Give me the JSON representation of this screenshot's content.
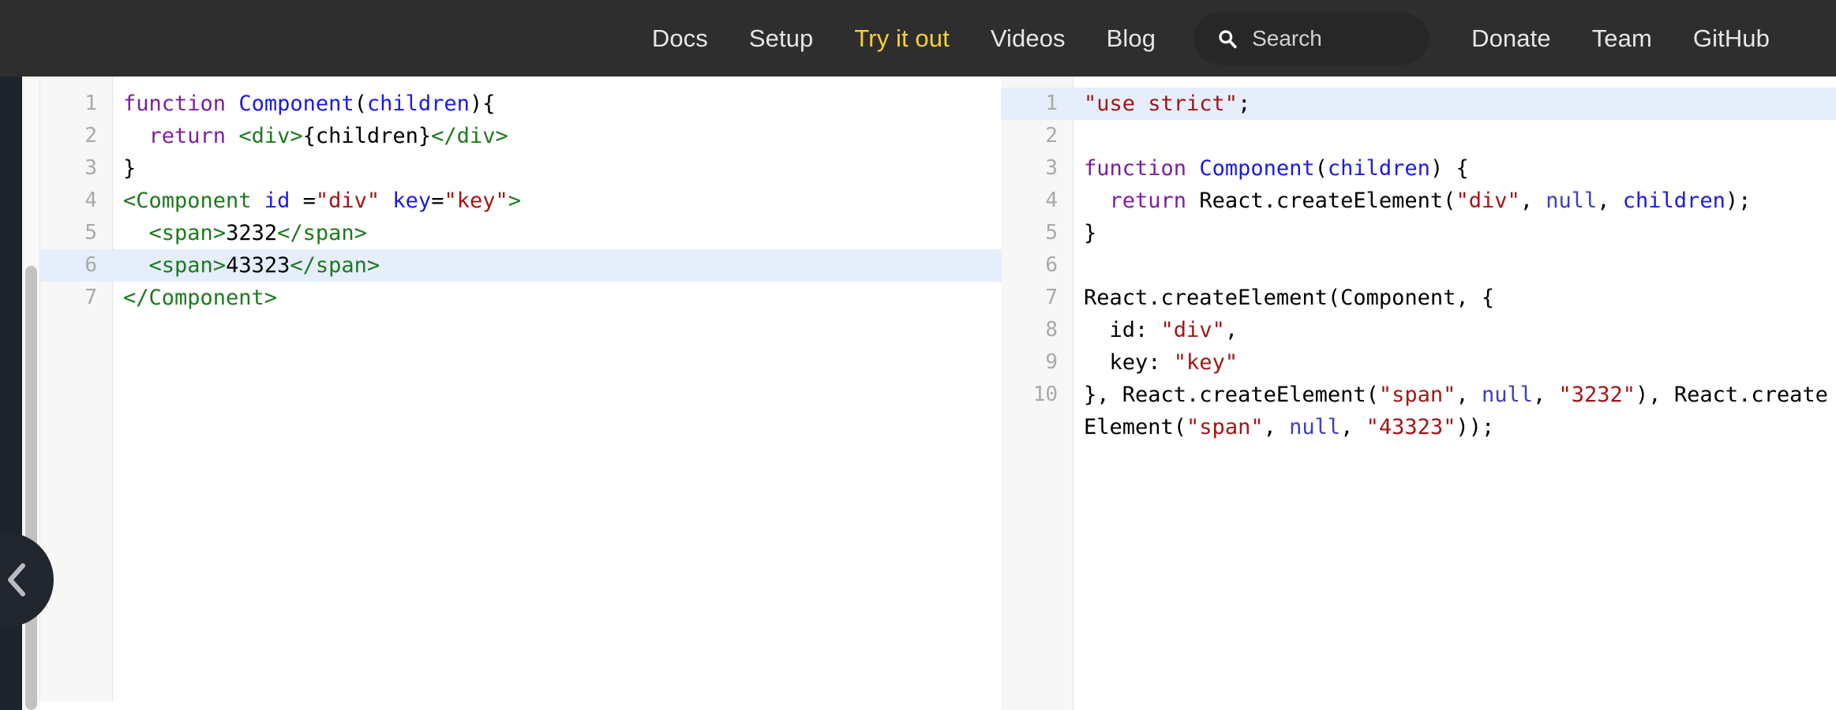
{
  "navbar": {
    "links": [
      {
        "label": "Docs",
        "name": "nav-link-docs",
        "active": false
      },
      {
        "label": "Setup",
        "name": "nav-link-setup",
        "active": false
      },
      {
        "label": "Try it out",
        "name": "nav-link-try-it-out",
        "active": true
      },
      {
        "label": "Videos",
        "name": "nav-link-videos",
        "active": false
      },
      {
        "label": "Blog",
        "name": "nav-link-blog",
        "active": false
      }
    ],
    "search": {
      "placeholder": "Search",
      "value": "",
      "icon": "search-icon"
    },
    "right_links": [
      {
        "label": "Donate",
        "name": "nav-link-donate"
      },
      {
        "label": "Team",
        "name": "nav-link-team"
      },
      {
        "label": "GitHub",
        "name": "nav-link-github"
      }
    ],
    "background_color": "#2e2e2e",
    "active_color": "#f5d033",
    "text_color": "#e6e6e6"
  },
  "sidebar": {
    "collapse_button": {
      "icon": "chevron-left-icon",
      "name": "sidebar-collapse-button"
    },
    "background_color": "#1e242e"
  },
  "editor_left": {
    "name": "source-code-editor",
    "highlighted_line": 6,
    "line_numbers": [
      "1",
      "2",
      "3",
      "4",
      "5",
      "6",
      "7"
    ],
    "lines": [
      {
        "number": "1",
        "highlight": false,
        "tokens": [
          {
            "text": "function",
            "cls": "t-kw"
          },
          {
            "text": " ",
            "cls": "t-plain"
          },
          {
            "text": "Component",
            "cls": "t-fn"
          },
          {
            "text": "(",
            "cls": "t-punct"
          },
          {
            "text": "children",
            "cls": "t-param"
          },
          {
            "text": "){",
            "cls": "t-punct"
          }
        ]
      },
      {
        "number": "2",
        "highlight": false,
        "tokens": [
          {
            "text": "  ",
            "cls": "t-plain"
          },
          {
            "text": "return",
            "cls": "t-kw"
          },
          {
            "text": " ",
            "cls": "t-plain"
          },
          {
            "text": "<div>",
            "cls": "t-tag"
          },
          {
            "text": "{children}",
            "cls": "t-plain"
          },
          {
            "text": "</div>",
            "cls": "t-tag"
          }
        ]
      },
      {
        "number": "3",
        "highlight": false,
        "tokens": [
          {
            "text": "}",
            "cls": "t-punct"
          }
        ]
      },
      {
        "number": "4",
        "highlight": false,
        "tokens": [
          {
            "text": "<Component",
            "cls": "t-tag"
          },
          {
            "text": " ",
            "cls": "t-plain"
          },
          {
            "text": "id",
            "cls": "t-attr"
          },
          {
            "text": " =",
            "cls": "t-punct"
          },
          {
            "text": "\"div\"",
            "cls": "t-str"
          },
          {
            "text": " ",
            "cls": "t-plain"
          },
          {
            "text": "key",
            "cls": "t-attr"
          },
          {
            "text": "=",
            "cls": "t-punct"
          },
          {
            "text": "\"key\"",
            "cls": "t-str"
          },
          {
            "text": ">",
            "cls": "t-tag"
          }
        ]
      },
      {
        "number": "5",
        "highlight": false,
        "tokens": [
          {
            "text": "  ",
            "cls": "t-plain"
          },
          {
            "text": "<span>",
            "cls": "t-tag"
          },
          {
            "text": "3232",
            "cls": "t-plain"
          },
          {
            "text": "</span>",
            "cls": "t-tag"
          }
        ]
      },
      {
        "number": "6",
        "highlight": true,
        "tokens": [
          {
            "text": "  ",
            "cls": "t-plain"
          },
          {
            "text": "<span>",
            "cls": "t-tag"
          },
          {
            "text": "43323",
            "cls": "t-plain"
          },
          {
            "text": "</span>",
            "cls": "t-tag"
          }
        ]
      },
      {
        "number": "7",
        "highlight": false,
        "tokens": [
          {
            "text": "</Component>",
            "cls": "t-tag"
          }
        ]
      }
    ],
    "plain_text": "function Component(children){\n  return <div>{children}</div>\n}\n<Component id =\"div\" key=\"key\">\n  <span>3232</span>\n  <span>43323</span>\n</Component>"
  },
  "editor_right": {
    "name": "compiled-output-editor",
    "highlighted_line": 1,
    "line_numbers": [
      "1",
      "2",
      "3",
      "4",
      "5",
      "6",
      "7",
      "8",
      "9",
      "10"
    ],
    "lines": [
      {
        "number": "1",
        "highlight": true,
        "wrap": false,
        "tokens": [
          {
            "text": "\"use strict\"",
            "cls": "t-str"
          },
          {
            "text": ";",
            "cls": "t-punct"
          }
        ]
      },
      {
        "number": "2",
        "highlight": false,
        "wrap": false,
        "tokens": [
          {
            "text": "",
            "cls": "t-plain"
          }
        ]
      },
      {
        "number": "3",
        "highlight": false,
        "wrap": false,
        "tokens": [
          {
            "text": "function",
            "cls": "t-kw"
          },
          {
            "text": " ",
            "cls": "t-plain"
          },
          {
            "text": "Component",
            "cls": "t-fn"
          },
          {
            "text": "(",
            "cls": "t-punct"
          },
          {
            "text": "children",
            "cls": "t-param"
          },
          {
            "text": ") {",
            "cls": "t-punct"
          }
        ]
      },
      {
        "number": "4",
        "highlight": false,
        "wrap": false,
        "tokens": [
          {
            "text": "  ",
            "cls": "t-plain"
          },
          {
            "text": "return",
            "cls": "t-kw"
          },
          {
            "text": " React.createElement(",
            "cls": "t-plain"
          },
          {
            "text": "\"div\"",
            "cls": "t-str"
          },
          {
            "text": ", ",
            "cls": "t-plain"
          },
          {
            "text": "null",
            "cls": "t-null"
          },
          {
            "text": ", ",
            "cls": "t-plain"
          },
          {
            "text": "children",
            "cls": "t-param"
          },
          {
            "text": ");",
            "cls": "t-plain"
          }
        ]
      },
      {
        "number": "5",
        "highlight": false,
        "wrap": false,
        "tokens": [
          {
            "text": "}",
            "cls": "t-punct"
          }
        ]
      },
      {
        "number": "6",
        "highlight": false,
        "wrap": false,
        "tokens": [
          {
            "text": "",
            "cls": "t-plain"
          }
        ]
      },
      {
        "number": "7",
        "highlight": false,
        "wrap": false,
        "tokens": [
          {
            "text": "React.createElement(Component, {",
            "cls": "t-plain"
          }
        ]
      },
      {
        "number": "8",
        "highlight": false,
        "wrap": false,
        "tokens": [
          {
            "text": "  id: ",
            "cls": "t-plain"
          },
          {
            "text": "\"div\"",
            "cls": "t-str"
          },
          {
            "text": ",",
            "cls": "t-plain"
          }
        ]
      },
      {
        "number": "9",
        "highlight": false,
        "wrap": false,
        "tokens": [
          {
            "text": "  key: ",
            "cls": "t-plain"
          },
          {
            "text": "\"key\"",
            "cls": "t-str"
          }
        ]
      },
      {
        "number": "10",
        "highlight": false,
        "wrap": true,
        "tokens": [
          {
            "text": "}, React.createElement(",
            "cls": "t-plain"
          },
          {
            "text": "\"span\"",
            "cls": "t-str"
          },
          {
            "text": ", ",
            "cls": "t-plain"
          },
          {
            "text": "null",
            "cls": "t-null"
          },
          {
            "text": ", ",
            "cls": "t-plain"
          },
          {
            "text": "\"3232\"",
            "cls": "t-str"
          },
          {
            "text": "), ",
            "cls": "t-plain"
          },
          {
            "text": "React.createElement(",
            "cls": "t-plain"
          },
          {
            "text": "\"span\"",
            "cls": "t-str"
          },
          {
            "text": ", ",
            "cls": "t-plain"
          },
          {
            "text": "null",
            "cls": "t-null"
          },
          {
            "text": ", ",
            "cls": "t-plain"
          },
          {
            "text": "\"43323\"",
            "cls": "t-str"
          },
          {
            "text": "));",
            "cls": "t-plain"
          }
        ]
      }
    ],
    "plain_text": "\"use strict\";\n\nfunction Component(children) {\n  return React.createElement(\"div\", null, children);\n}\n\nReact.createElement(Component, {\n  id: \"div\",\n  key: \"key\"\n}, React.createElement(\"span\", null, \"3232\"), React.createElement(\"span\", null, \"43323\"));"
  },
  "colors": {
    "keyword": "#7b1fa2",
    "function_name": "#1a1ae6",
    "tag": "#1c7a1c",
    "string": "#a31515",
    "null_literal": "#3c3cc8",
    "line_number": "#a9a9a9",
    "line_highlight": "#e6eefc",
    "editor_background": "#ffffff",
    "gutter_background": "#f7f7f7"
  }
}
